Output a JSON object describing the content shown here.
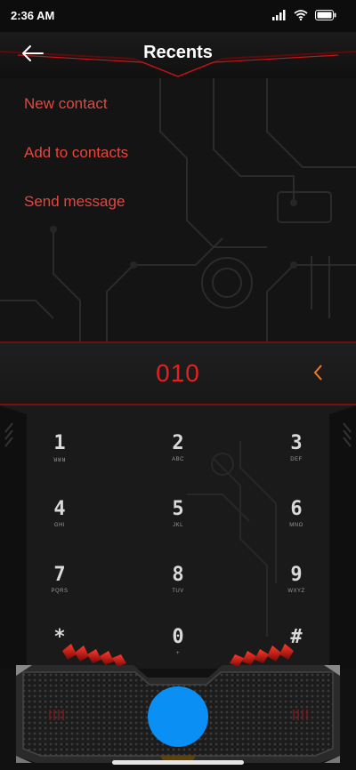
{
  "status_bar": {
    "time": "2:36 AM"
  },
  "header": {
    "title": "Recents"
  },
  "options": [
    {
      "label": "New contact"
    },
    {
      "label": "Add to contacts"
    },
    {
      "label": "Send message"
    }
  ],
  "dial": {
    "number": "010"
  },
  "keypad": [
    {
      "digit": "1",
      "letters": "ꓤꓤꓤ"
    },
    {
      "digit": "2",
      "letters": "ABC"
    },
    {
      "digit": "3",
      "letters": "DEF"
    },
    {
      "digit": "4",
      "letters": "GHI"
    },
    {
      "digit": "5",
      "letters": "JKL"
    },
    {
      "digit": "6",
      "letters": "MNO"
    },
    {
      "digit": "7",
      "letters": "PQRS"
    },
    {
      "digit": "8",
      "letters": "TUV"
    },
    {
      "digit": "9",
      "letters": "WXYZ"
    },
    {
      "digit": "*",
      "letters": ""
    },
    {
      "digit": "0",
      "letters": "+"
    },
    {
      "digit": "#",
      "letters": ""
    }
  ],
  "colors": {
    "accent": "#e8453c",
    "call": "#0a8ff5"
  }
}
